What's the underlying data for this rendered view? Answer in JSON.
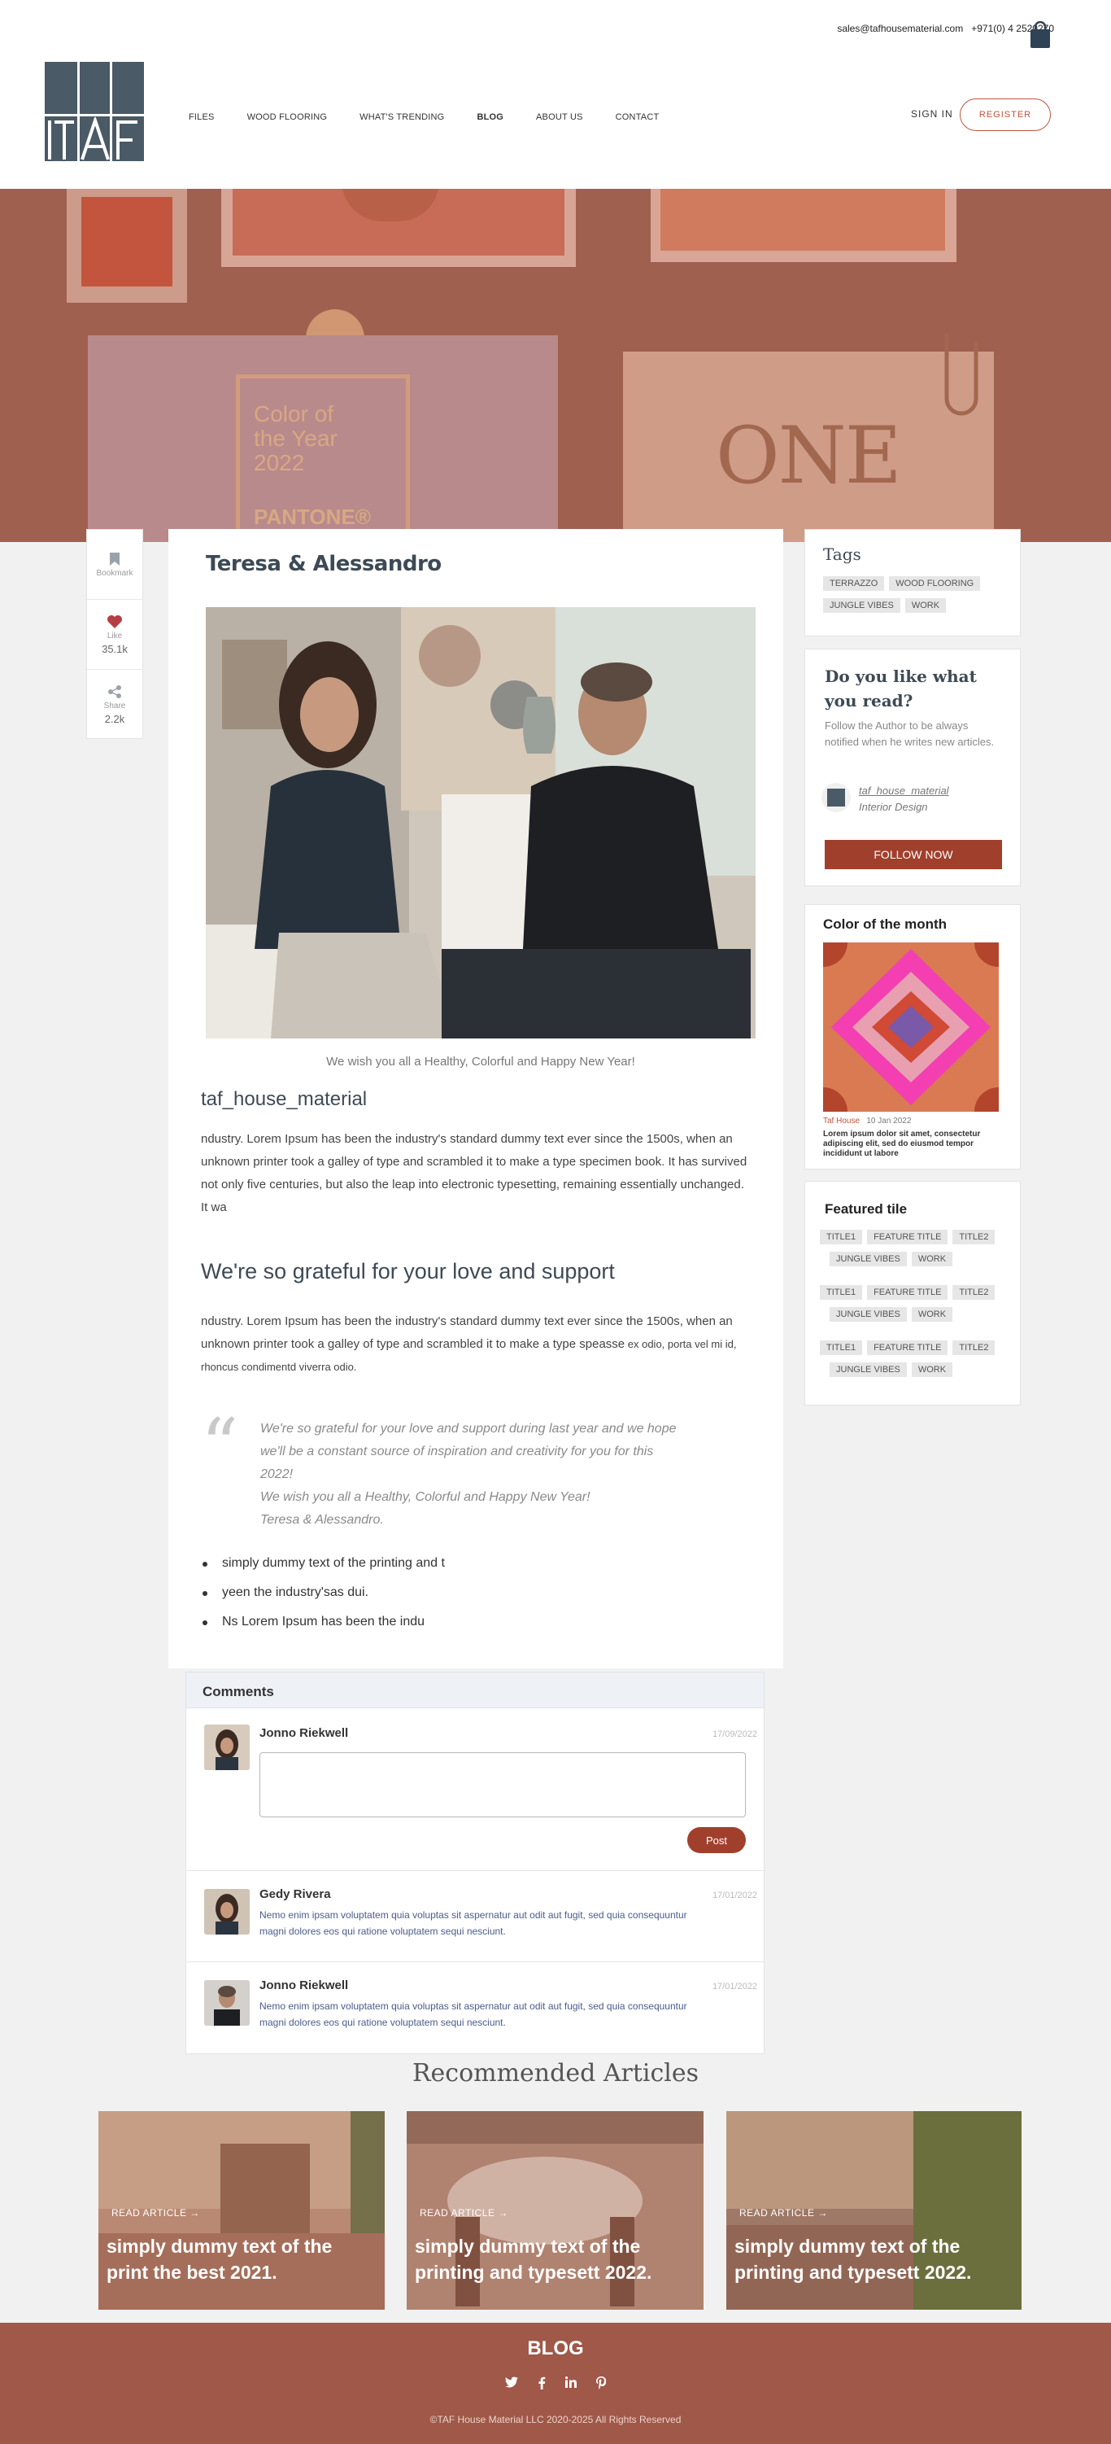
{
  "header": {
    "email": "sales@tafhousematerial.com",
    "phone": "+971(0) 4 2520270",
    "logo_text": "TAF",
    "nav": [
      "FILES",
      "WOOD FLOORING",
      "WHAT'S TRENDING",
      "BLOG",
      "ABOUT US",
      "CONTACT"
    ],
    "signin": "SIGN IN",
    "register": "REGISTER"
  },
  "hero": {
    "swatch_text_line1": "Color of",
    "swatch_text_line2": "the Year",
    "swatch_text_line3": "2022",
    "pantone": "PANTONE®",
    "one": "ONE"
  },
  "actions": {
    "bookmark": "Bookmark",
    "like": "Like",
    "like_count": "35.1k",
    "share": "Share",
    "share_count": "2.2k"
  },
  "article": {
    "title": "Teresa & Alessandro",
    "caption": "We wish you all a Healthy, Colorful and Happy New Year!",
    "author": "taf_house_material",
    "para1": "ndustry. Lorem Ipsum has been the industry's standard dummy text ever since the 1500s, when an unknown printer took a galley of type and scrambled it to make a type specimen book. It has survived not only five centuries, but also the leap into electronic typesetting, remaining essentially unchanged. It wa",
    "subheading": "We're so grateful for your love and support",
    "para2_main": "ndustry. Lorem Ipsum has been the industry's standard dummy text ever since the 1500s, when an unknown printer took a galley of type and scrambled it to make a type speasse",
    "para2_small": " ex odio, porta vel mi id, rhoncus condimentd viverra odio.",
    "quote": [
      "We're so grateful for your love and support during last year and we hope",
      "we'll be a constant source of inspiration and creativity for you for this",
      "2022!",
      "We wish you all a Healthy, Colorful and Happy New Year!",
      "Teresa & Alessandro."
    ],
    "bullets": [
      "simply dummy text of the printing and t",
      "yeen the industry'sas dui.",
      "Ns Lorem Ipsum has been the indu"
    ]
  },
  "comments": {
    "heading": "Comments",
    "current_user": "Jonno Riekwell",
    "current_date": "17/09/2022",
    "post_label": "Post",
    "items": [
      {
        "name": "Gedy Rivera",
        "date": "17/01/2022",
        "text": "Nemo enim ipsam voluptatem quia voluptas sit aspernatur aut odit aut fugit, sed quia consequuntur magni dolores eos qui ratione voluptatem sequi nesciunt."
      },
      {
        "name": "Jonno Riekwell",
        "date": "17/01/2022",
        "text": "Nemo enim ipsam voluptatem quia voluptas sit aspernatur aut odit aut fugit, sed quia consequuntur magni dolores eos qui ratione voluptatem sequi nesciunt."
      }
    ]
  },
  "recommended": {
    "title": "Recommended Articles",
    "read_label": "READ ARTICLE",
    "cards": [
      {
        "text": "simply dummy text of the print the best 2021."
      },
      {
        "text": "simply dummy text of the printing and typesett 2022."
      },
      {
        "text": "simply dummy text of the printing and typesett 2022."
      }
    ]
  },
  "sidebar": {
    "tags_title": "Tags",
    "tags": [
      "TERRAZZO",
      "WOOD FLOORING",
      "JUNGLE VIBES",
      "WORK"
    ],
    "follow_title": "Do you like what you read?",
    "follow_desc": "Follow the Author to be always notified when he writes new articles.",
    "follow_name": "taf_house_material",
    "follow_role": "Interior Design",
    "follow_btn": "FOLLOW NOW",
    "color_title": "Color of the month",
    "color_author": "Taf House",
    "color_date": "10 Jan 2022",
    "color_desc": "Lorem ipsum dolor sit amet, consectetur adipiscing elit, sed do eiusmod tempor incididunt ut labore",
    "featured_title": "Featured tile",
    "featured_groups": [
      [
        "TITLE1",
        "FEATURE TITLE",
        "TITLE2",
        "JUNGLE VIBES",
        "WORK"
      ],
      [
        "TITLE1",
        "FEATURE TITLE",
        "TITLE2",
        "JUNGLE VIBES",
        "WORK"
      ],
      [
        "TITLE1",
        "FEATURE TITLE",
        "TITLE2",
        "JUNGLE VIBES",
        "WORK"
      ]
    ]
  },
  "footer": {
    "title": "BLOG",
    "icons": [
      "twitter-icon",
      "facebook-icon",
      "linkedin-icon",
      "pinterest-icon"
    ],
    "copyright": "©TAF House Material LLC 2020-2025 All Rights Reserved"
  },
  "colors": {
    "accent": "#a0402c",
    "hero": "#a0604f",
    "footer": "#a05848",
    "heading": "#3d4a55"
  }
}
